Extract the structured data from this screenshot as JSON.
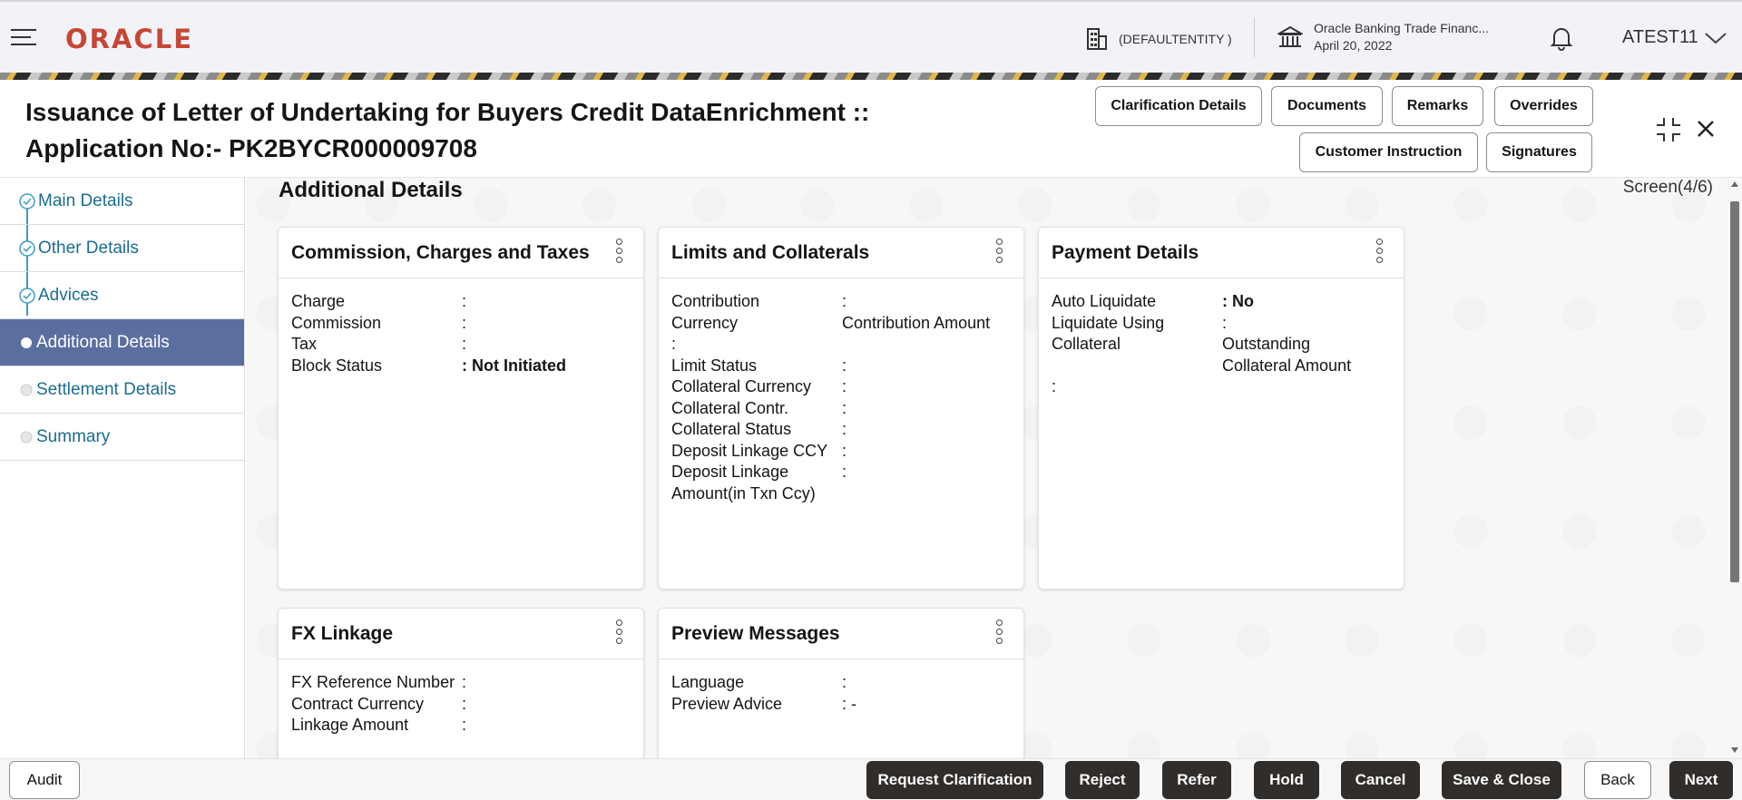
{
  "header": {
    "logo": "ORACLE",
    "entity": "(DEFAULTENTITY )",
    "branch_name": "Oracle Banking Trade Financ...",
    "branch_date": "April 20, 2022",
    "user": "ATEST11"
  },
  "title": {
    "line1": "Issuance of Letter of Undertaking for Buyers Credit DataEnrichment ::",
    "line2": "Application No:- PK2BYCR000009708"
  },
  "toolbar": {
    "clarification": "Clarification Details",
    "documents": "Documents",
    "remarks": "Remarks",
    "overrides": "Overrides",
    "customer_instruction": "Customer Instruction",
    "signatures": "Signatures"
  },
  "sidebar": {
    "items": [
      {
        "label": "Main Details"
      },
      {
        "label": "Other Details"
      },
      {
        "label": "Advices"
      },
      {
        "label": "Additional Details"
      },
      {
        "label": "Settlement Details"
      },
      {
        "label": "Summary"
      }
    ]
  },
  "main": {
    "section_title": "Additional Details",
    "screen": "Screen(4/6)"
  },
  "cards": {
    "commission": {
      "title": "Commission, Charges and Taxes",
      "rows": [
        {
          "label": "Charge",
          "value": ":"
        },
        {
          "label": "Commission",
          "value": ":"
        },
        {
          "label": "Tax",
          "value": ":"
        },
        {
          "label": "Block Status",
          "value": ": Not Initiated"
        }
      ]
    },
    "limits": {
      "title": "Limits and Collaterals",
      "contribution": "Contribution",
      "currency": "Currency",
      "contribution_amount": "Contribution Amount",
      "colon": ":",
      "rows": [
        {
          "label": "Limit Status",
          "value": ":"
        },
        {
          "label": "Collateral Currency",
          "value": ":"
        },
        {
          "label": "Collateral Contr.",
          "value": ":"
        },
        {
          "label": "Collateral Status",
          "value": ":"
        },
        {
          "label": "Deposit Linkage CCY",
          "value": ":"
        }
      ],
      "deposit_amount_1": "Deposit Linkage",
      "deposit_amount_2": "Amount(in Txn Ccy)"
    },
    "payment": {
      "title": "Payment Details",
      "auto_liquidate": "Auto Liquidate",
      "auto_liquidate_value": ": No",
      "liquidate_using": "Liquidate Using",
      "collateral": "Collateral",
      "outstanding_1": "Outstanding",
      "outstanding_2": "Collateral Amount",
      "colon": ":"
    },
    "fx": {
      "title": "FX Linkage",
      "rows": [
        {
          "label": "FX Reference Number",
          "value": ":"
        },
        {
          "label": "Contract Currency",
          "value": ":"
        },
        {
          "label": "Linkage Amount",
          "value": ":"
        }
      ]
    },
    "preview": {
      "title": "Preview Messages",
      "rows": [
        {
          "label": "Language",
          "value": ":"
        },
        {
          "label": "Preview Advice",
          "value": ": -"
        }
      ]
    }
  },
  "footer": {
    "audit": "Audit",
    "request_clarification": "Request Clarification",
    "reject": "Reject",
    "refer": "Refer",
    "hold": "Hold",
    "cancel": "Cancel",
    "save_close": "Save & Close",
    "back": "Back",
    "next": "Next"
  },
  "colors": {
    "brand": "#c74634",
    "active_nav": "#5b6ea0",
    "link": "#1b6d8f",
    "dark_button": "#312d2a"
  }
}
